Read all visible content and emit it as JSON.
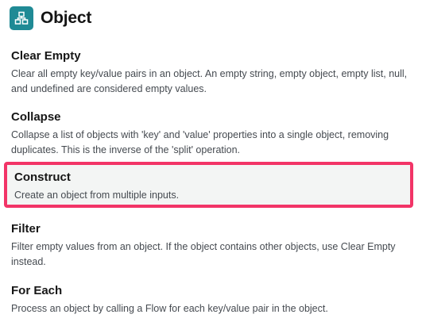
{
  "header": {
    "title": "Object",
    "icon": "object-boxes-icon",
    "icon_color": "#1f8a95"
  },
  "highlight_color": "#f23467",
  "items": [
    {
      "title": "Clear Empty",
      "description": "Clear all empty key/value pairs in an object. An empty string, empty object, empty list, null, and undefined are considered empty values."
    },
    {
      "title": "Collapse",
      "description": "Collapse a list of objects with 'key' and 'value' properties into a single object, removing duplicates. This is the inverse of the 'split' operation."
    },
    {
      "title": "Construct",
      "description": "Create an object from multiple inputs.",
      "selected": true
    },
    {
      "title": "Filter",
      "description": "Filter empty values from an object. If the object contains other objects, use Clear Empty instead."
    },
    {
      "title": "For Each",
      "description": "Process an object by calling a Flow for each key/value pair in the object."
    }
  ]
}
